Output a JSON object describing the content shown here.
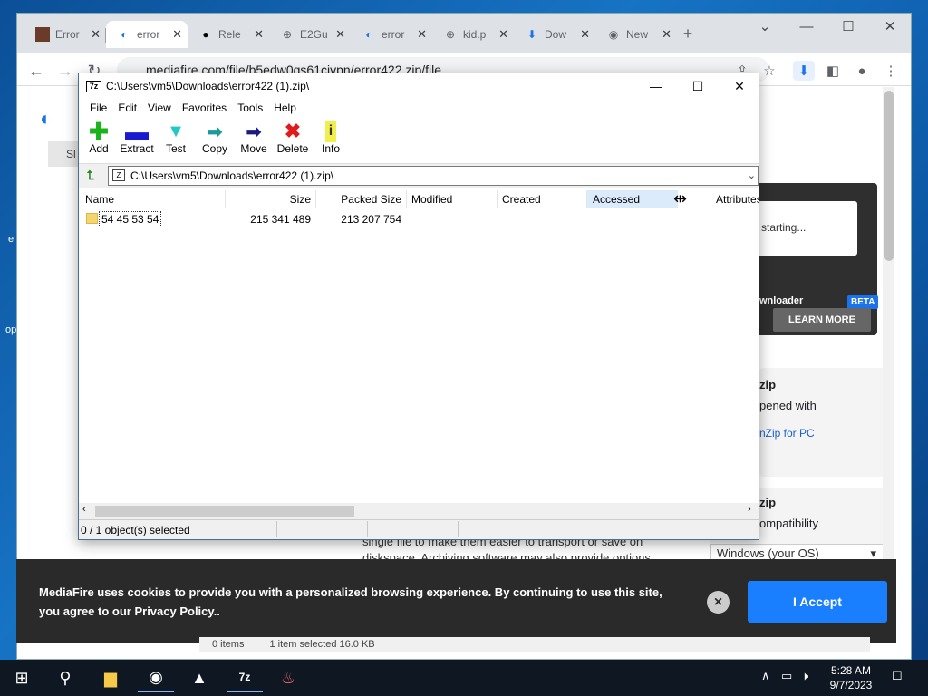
{
  "browser": {
    "tabs": [
      {
        "label": "Error",
        "icon": "image-icon"
      },
      {
        "label": "error",
        "icon": "mediafire-icon",
        "active": true
      },
      {
        "label": "Rele",
        "icon": "github-icon"
      },
      {
        "label": "E2Gu",
        "icon": "globe-icon"
      },
      {
        "label": "error",
        "icon": "mediafire-icon"
      },
      {
        "label": "kid.p",
        "icon": "globe-icon"
      },
      {
        "label": "Dow",
        "icon": "download-icon"
      },
      {
        "label": "New",
        "icon": "chrome-icon"
      }
    ],
    "new_tab": "+",
    "url": "mediafire.com/file/b5edw0qs61civpn/error422.zip/file"
  },
  "page": {
    "sign_in": "Sl",
    "starting": "d is starting...",
    "downloader": "wnloader",
    "beta": "BETA",
    "learn_more": "LEARN MORE",
    "zip1": "zip",
    "opened_with": "pened with",
    "app_for_pc": "nZip for PC",
    "zip2": "zip",
    "compat": "ompatibility",
    "os_select": "Windows (your OS)",
    "body1": "single file to make them easier to transport or save on",
    "body2": "diskspace. Archiving software may also provide options",
    "desk_e": "e",
    "desk_op": "op",
    "footer_items": "0 items",
    "footer_sel": "1 item selected   16.0 KB"
  },
  "cookie": {
    "text": "MediaFire uses cookies to provide you with a personalized browsing experience. By continuing to use this site, you agree to our Privacy Policy..",
    "accept": "I Accept",
    "close": "×"
  },
  "sevenzip": {
    "logo": "7z",
    "title": "C:\\Users\\vm5\\Downloads\\error422 (1).zip\\",
    "menu": [
      "File",
      "Edit",
      "View",
      "Favorites",
      "Tools",
      "Help"
    ],
    "toolbar": [
      {
        "label": "Add",
        "icon": "add-icon"
      },
      {
        "label": "Extract",
        "icon": "extract-icon"
      },
      {
        "label": "Test",
        "icon": "test-icon"
      },
      {
        "label": "Copy",
        "icon": "copy-icon"
      },
      {
        "label": "Move",
        "icon": "move-icon"
      },
      {
        "label": "Delete",
        "icon": "delete-icon"
      },
      {
        "label": "Info",
        "icon": "info-icon"
      }
    ],
    "address": "C:\\Users\\vm5\\Downloads\\error422 (1).zip\\",
    "columns": [
      "Name",
      "Size",
      "Packed Size",
      "Modified",
      "Created",
      "Accessed",
      "Attributes"
    ],
    "rows": [
      {
        "name": "54 45 53 54",
        "size": "215 341 489",
        "packed": "213 207 754",
        "modified": "",
        "created": "",
        "accessed": "",
        "attributes": ""
      }
    ],
    "status": "0 / 1 object(s) selected"
  },
  "taskbar": {
    "time": "5:28 AM",
    "date": "9/7/2023"
  }
}
